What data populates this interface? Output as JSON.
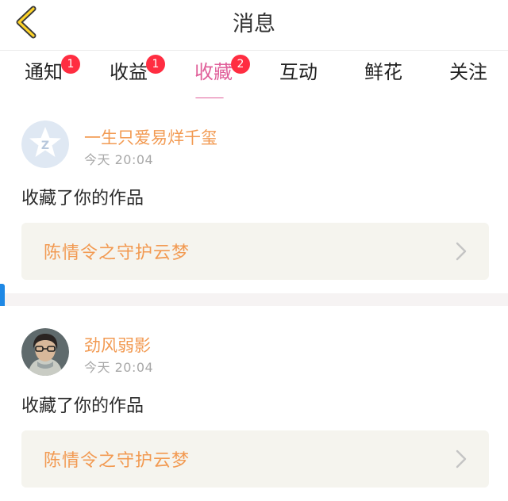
{
  "header": {
    "title": "消息",
    "back_icon": "chevron-left-icon"
  },
  "tabs": [
    {
      "label": "通知",
      "badge": "1",
      "active": false
    },
    {
      "label": "收益",
      "badge": "1",
      "active": false
    },
    {
      "label": "收藏",
      "badge": "2",
      "active": true
    },
    {
      "label": "互动",
      "badge": "",
      "active": false
    },
    {
      "label": "鲜花",
      "badge": "",
      "active": false
    },
    {
      "label": "关注",
      "badge": "",
      "active": false
    }
  ],
  "notifications": [
    {
      "user": "一生只爱易烊千玺",
      "avatar": "default-star-avatar",
      "time": "今天 20:04",
      "message": "收藏了你的作品",
      "work_title": "陈情令之守护云梦"
    },
    {
      "user": "劲风弱影",
      "avatar": "user-photo-avatar",
      "time": "今天 20:04",
      "message": "收藏了你的作品",
      "work_title": "陈情令之守护云梦"
    }
  ],
  "colors": {
    "accent": "#e0609a",
    "badge": "#ff2d41",
    "username": "#f29a52",
    "link_bg": "#f5f4ee"
  }
}
